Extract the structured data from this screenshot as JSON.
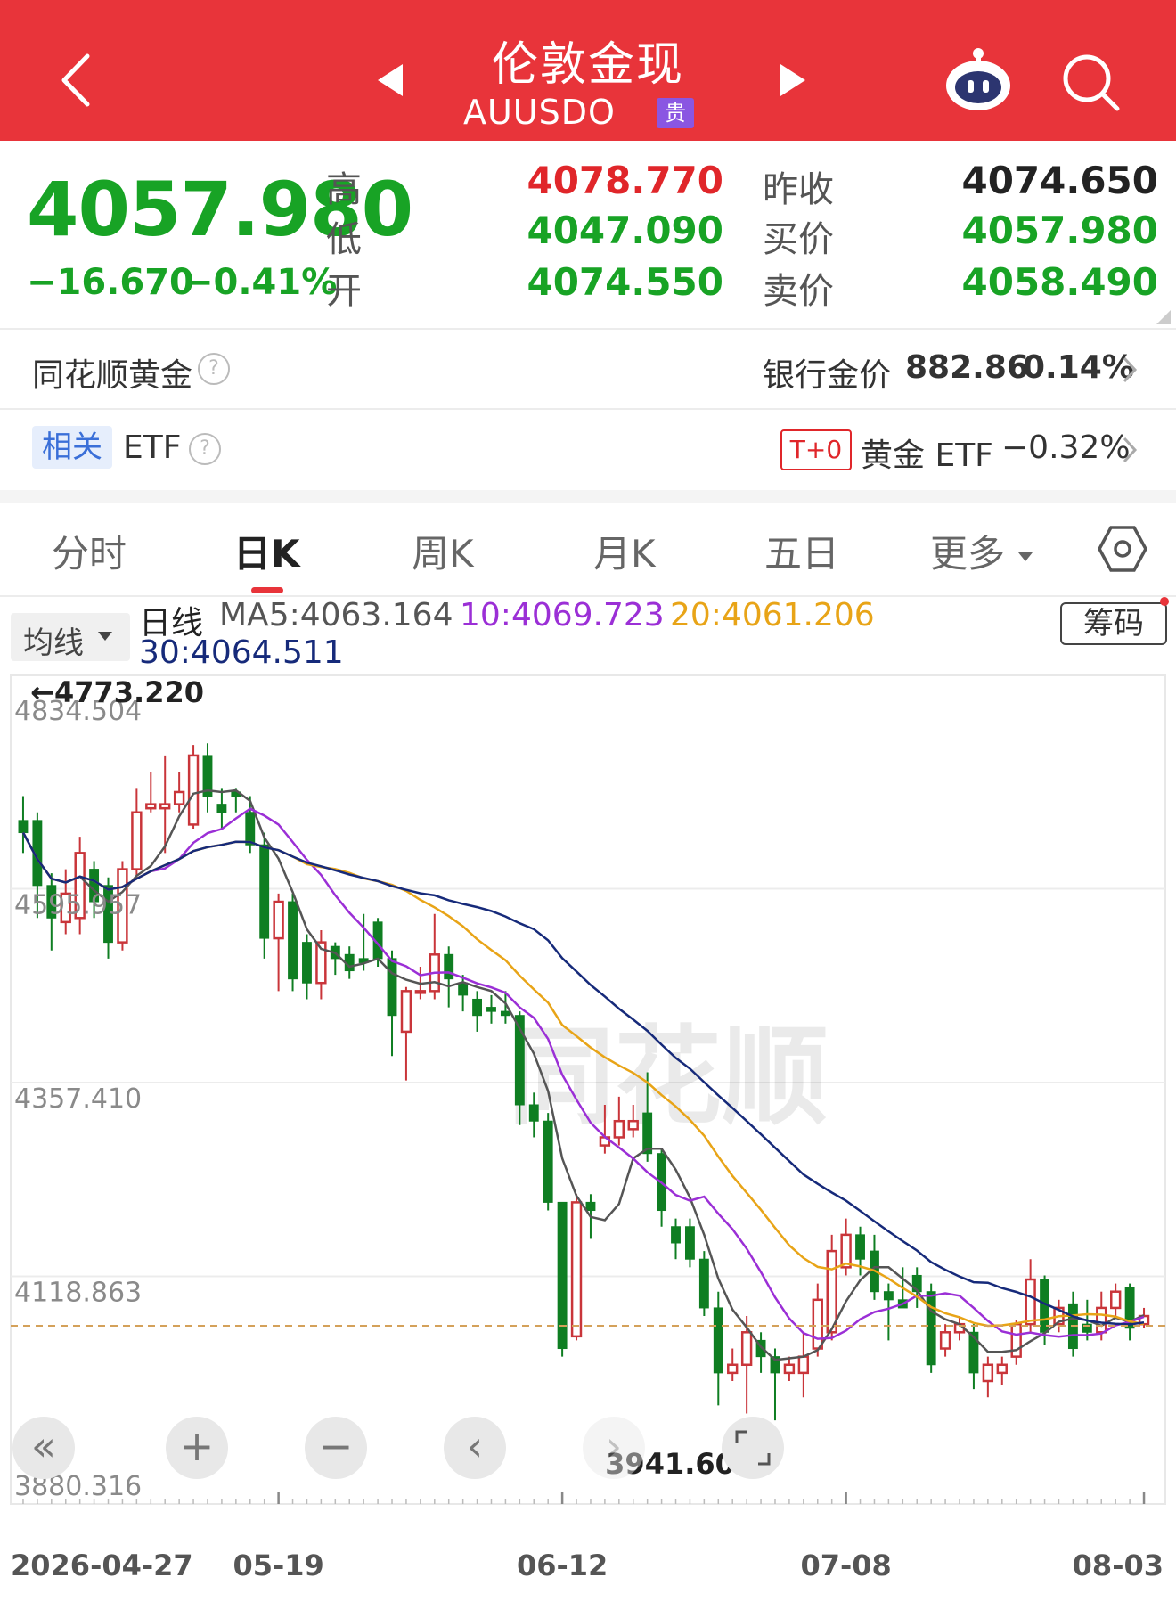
{
  "header": {
    "title": "伦敦金现",
    "code": "AUUSDO",
    "badge": "贵"
  },
  "quote": {
    "price": "4057.980",
    "change": "−16.670",
    "change_pct": "−0.41%",
    "high_label": "高",
    "low_label": "低",
    "open_label": "开",
    "high": "4078.770",
    "low": "4047.090",
    "open": "4074.550",
    "prev_close_label": "昨收",
    "bid_label": "买价",
    "ask_label": "卖价",
    "prev_close": "4074.650",
    "bid": "4057.980",
    "ask": "4058.490"
  },
  "ths_gold": {
    "label": "同花顺黄金",
    "help": "?",
    "bank_label": "银行金价",
    "bank_price": "882.86",
    "bank_pct": "0.14%"
  },
  "etf_row": {
    "tag": "相关",
    "label": "ETF",
    "help": "?",
    "t0_badge": "T+0",
    "etf_name": "黄金 ETF",
    "etf_pct": "−0.32%"
  },
  "tabs": [
    "分时",
    "日K",
    "周K",
    "月K",
    "五日",
    "更多"
  ],
  "settings_icon": "hexagon-gear-icon",
  "chart_controls": {
    "ma_dropdown": "均线",
    "chips_button": "筹码"
  },
  "ma_legend": {
    "period": "日线",
    "ma5": "MA5:4063.164",
    "ma10": "10:4069.723",
    "ma20": "20:4061.206",
    "ma30": "30:4064.511"
  },
  "colors": {
    "header": "#e8343a",
    "up": "#e0262a",
    "down": "#18a325",
    "candle_up": "#c9353a",
    "candle_down": "#0f7e22",
    "ma5": "#555555",
    "ma10": "#9b2fd6",
    "ma20": "#e8a417",
    "ma30": "#162a7a"
  },
  "chart_data": {
    "type": "candlestick",
    "y_axis_labels": [
      "4834.504",
      "4595.957",
      "4357.410",
      "4118.863",
      "3880.316"
    ],
    "ylim": [
      3880.316,
      4834.504
    ],
    "x_tick_labels": [
      "2026-04-27",
      "05-19",
      "06-12",
      "07-08",
      "08-03"
    ],
    "annotations": {
      "max_label": "←4773.220",
      "min_label": "3941.600→"
    },
    "current_price": 4057.98,
    "candles": [
      {
        "o": 4680,
        "c": 4665,
        "h": 4710,
        "l": 4640
      },
      {
        "o": 4680,
        "c": 4600,
        "h": 4690,
        "l": 4560
      },
      {
        "o": 4600,
        "c": 4560,
        "h": 4615,
        "l": 4520
      },
      {
        "o": 4555,
        "c": 4590,
        "h": 4620,
        "l": 4540
      },
      {
        "o": 4560,
        "c": 4640,
        "h": 4660,
        "l": 4540
      },
      {
        "o": 4620,
        "c": 4580,
        "h": 4630,
        "l": 4560
      },
      {
        "o": 4600,
        "c": 4530,
        "h": 4610,
        "l": 4510
      },
      {
        "o": 4530,
        "c": 4620,
        "h": 4630,
        "l": 4520
      },
      {
        "o": 4620,
        "c": 4690,
        "h": 4720,
        "l": 4610
      },
      {
        "o": 4695,
        "c": 4700,
        "h": 4740,
        "l": 4690
      },
      {
        "o": 4695,
        "c": 4700,
        "h": 4760,
        "l": 4640
      },
      {
        "o": 4700,
        "c": 4715,
        "h": 4740,
        "l": 4690
      },
      {
        "o": 4675,
        "c": 4760,
        "h": 4773,
        "l": 4670
      },
      {
        "o": 4760,
        "c": 4710,
        "h": 4775,
        "l": 4690
      },
      {
        "o": 4700,
        "c": 4690,
        "h": 4720,
        "l": 4670
      },
      {
        "o": 4715,
        "c": 4710,
        "h": 4720,
        "l": 4690
      },
      {
        "o": 4690,
        "c": 4650,
        "h": 4710,
        "l": 4640
      },
      {
        "o": 4650,
        "c": 4535,
        "h": 4665,
        "l": 4510
      },
      {
        "o": 4535,
        "c": 4580,
        "h": 4590,
        "l": 4470
      },
      {
        "o": 4580,
        "c": 4485,
        "h": 4590,
        "l": 4470
      },
      {
        "o": 4530,
        "c": 4480,
        "h": 4540,
        "l": 4460
      },
      {
        "o": 4480,
        "c": 4530,
        "h": 4545,
        "l": 4460
      },
      {
        "o": 4525,
        "c": 4510,
        "h": 4530,
        "l": 4490
      },
      {
        "o": 4515,
        "c": 4495,
        "h": 4525,
        "l": 4485
      },
      {
        "o": 4510,
        "c": 4505,
        "h": 4565,
        "l": 4495
      },
      {
        "o": 4555,
        "c": 4510,
        "h": 4560,
        "l": 4500
      },
      {
        "o": 4510,
        "c": 4440,
        "h": 4520,
        "l": 4390
      },
      {
        "o": 4420,
        "c": 4470,
        "h": 4475,
        "l": 4360
      },
      {
        "o": 4470,
        "c": 4470,
        "h": 4500,
        "l": 4460
      },
      {
        "o": 4470,
        "c": 4515,
        "h": 4565,
        "l": 4460
      },
      {
        "o": 4515,
        "c": 4485,
        "h": 4525,
        "l": 4450
      },
      {
        "o": 4480,
        "c": 4465,
        "h": 4490,
        "l": 4445
      },
      {
        "o": 4460,
        "c": 4440,
        "h": 4470,
        "l": 4420
      },
      {
        "o": 4450,
        "c": 4445,
        "h": 4465,
        "l": 4430
      },
      {
        "o": 4445,
        "c": 4440,
        "h": 4470,
        "l": 4430
      },
      {
        "o": 4440,
        "c": 4330,
        "h": 4445,
        "l": 4305
      },
      {
        "o": 4330,
        "c": 4310,
        "h": 4345,
        "l": 4290
      },
      {
        "o": 4310,
        "c": 4210,
        "h": 4320,
        "l": 4200
      },
      {
        "o": 4210,
        "c": 4030,
        "h": 4210,
        "l": 4020
      },
      {
        "o": 4045,
        "c": 4210,
        "h": 4220,
        "l": 4040
      },
      {
        "o": 4210,
        "c": 4200,
        "h": 4220,
        "l": 4165
      },
      {
        "o": 4280,
        "c": 4290,
        "h": 4330,
        "l": 4270
      },
      {
        "o": 4290,
        "c": 4310,
        "h": 4340,
        "l": 4280
      },
      {
        "o": 4300,
        "c": 4310,
        "h": 4330,
        "l": 4290
      },
      {
        "o": 4320,
        "c": 4270,
        "h": 4370,
        "l": 4260
      },
      {
        "o": 4270,
        "c": 4200,
        "h": 4275,
        "l": 4180
      },
      {
        "o": 4180,
        "c": 4160,
        "h": 4190,
        "l": 4140
      },
      {
        "o": 4180,
        "c": 4140,
        "h": 4190,
        "l": 4130
      },
      {
        "o": 4140,
        "c": 4080,
        "h": 4150,
        "l": 4070
      },
      {
        "o": 4080,
        "c": 4000,
        "h": 4100,
        "l": 3960
      },
      {
        "o": 4000,
        "c": 4010,
        "h": 4030,
        "l": 3990
      },
      {
        "o": 4010,
        "c": 4050,
        "h": 4070,
        "l": 3950
      },
      {
        "o": 4040,
        "c": 4020,
        "h": 4050,
        "l": 4000
      },
      {
        "o": 4020,
        "c": 4000,
        "h": 4030,
        "l": 3941.6
      },
      {
        "o": 4000,
        "c": 4010,
        "h": 4020,
        "l": 3990
      },
      {
        "o": 4000,
        "c": 4020,
        "h": 4050,
        "l": 3970
      },
      {
        "o": 4030,
        "c": 4090,
        "h": 4110,
        "l": 4020
      },
      {
        "o": 4050,
        "c": 4150,
        "h": 4170,
        "l": 4040
      },
      {
        "o": 4130,
        "c": 4170,
        "h": 4190,
        "l": 4120
      },
      {
        "o": 4170,
        "c": 4140,
        "h": 4180,
        "l": 4120
      },
      {
        "o": 4150,
        "c": 4100,
        "h": 4170,
        "l": 4090
      },
      {
        "o": 4100,
        "c": 4090,
        "h": 4110,
        "l": 4040
      },
      {
        "o": 4090,
        "c": 4080,
        "h": 4130,
        "l": 4080
      },
      {
        "o": 4120,
        "c": 4100,
        "h": 4130,
        "l": 4080
      },
      {
        "o": 4100,
        "c": 4010,
        "h": 4110,
        "l": 4000
      },
      {
        "o": 4030,
        "c": 4050,
        "h": 4060,
        "l": 4020
      },
      {
        "o": 4050,
        "c": 4060,
        "h": 4070,
        "l": 4040
      },
      {
        "o": 4050,
        "c": 4000,
        "h": 4060,
        "l": 3980
      },
      {
        "o": 3990,
        "c": 4010,
        "h": 4020,
        "l": 3970
      },
      {
        "o": 4000,
        "c": 4010,
        "h": 4020,
        "l": 3985
      },
      {
        "o": 4020,
        "c": 4060,
        "h": 4065,
        "l": 4010
      },
      {
        "o": 4060,
        "c": 4115,
        "h": 4140,
        "l": 4050
      },
      {
        "o": 4115,
        "c": 4050,
        "h": 4120,
        "l": 4035
      },
      {
        "o": 4060,
        "c": 4080,
        "h": 4090,
        "l": 4050
      },
      {
        "o": 4085,
        "c": 4030,
        "h": 4100,
        "l": 4020
      },
      {
        "o": 4060,
        "c": 4050,
        "h": 4090,
        "l": 4040
      },
      {
        "o": 4050,
        "c": 4080,
        "h": 4100,
        "l": 4040
      },
      {
        "o": 4080,
        "c": 4100,
        "h": 4110,
        "l": 4070
      },
      {
        "o": 4105,
        "c": 4055,
        "h": 4110,
        "l": 4040
      },
      {
        "o": 4060,
        "c": 4070,
        "h": 4080,
        "l": 4055
      }
    ]
  }
}
